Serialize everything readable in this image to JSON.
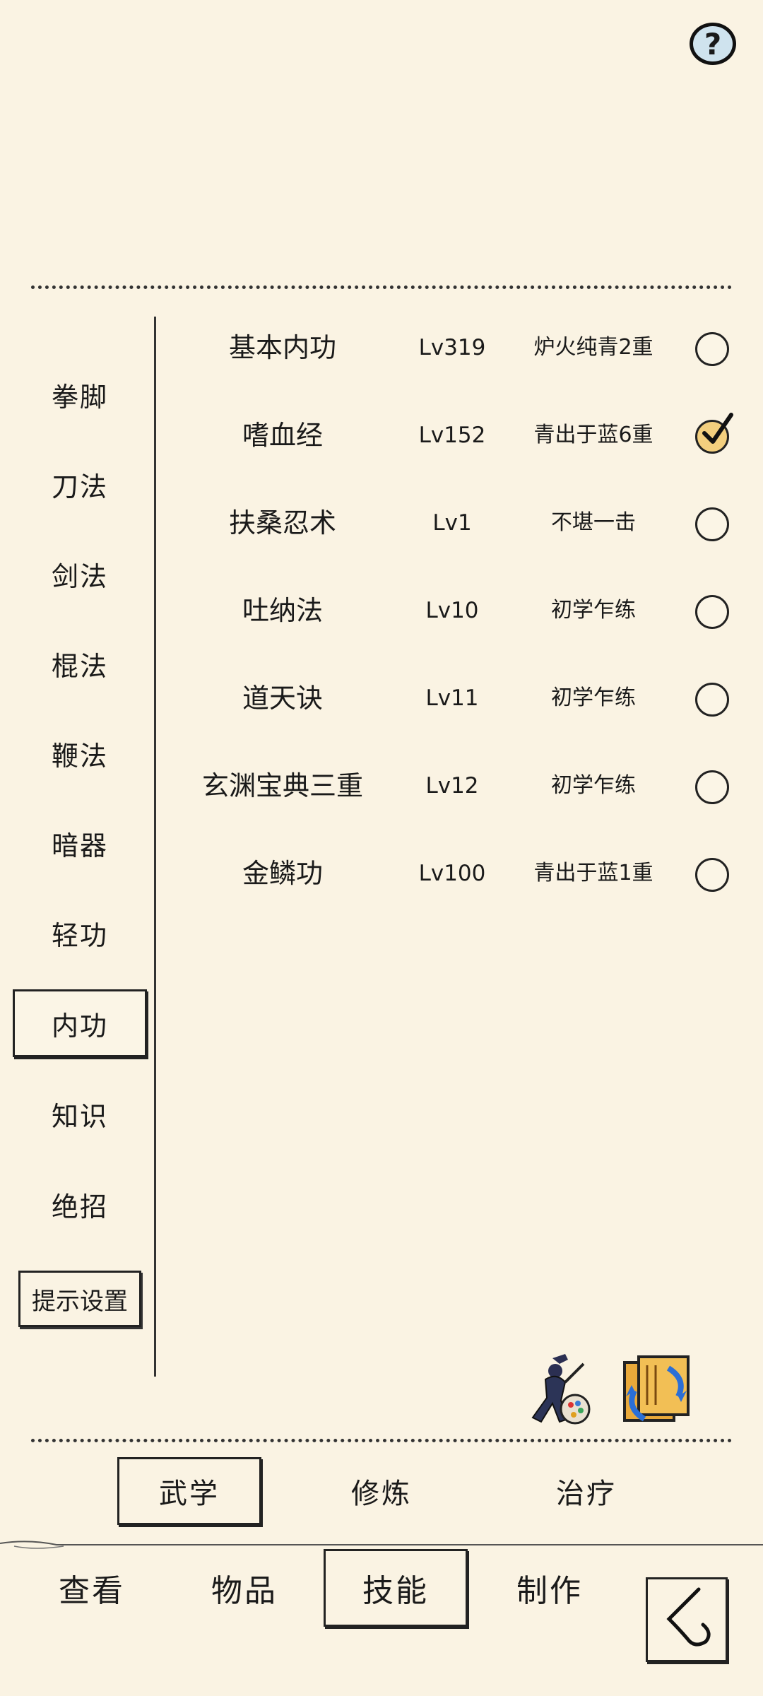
{
  "header": {
    "help_label": "?"
  },
  "categories": [
    {
      "label": "拳脚"
    },
    {
      "label": "刀法"
    },
    {
      "label": "剑法"
    },
    {
      "label": "棍法"
    },
    {
      "label": "鞭法"
    },
    {
      "label": "暗器"
    },
    {
      "label": "轻功"
    },
    {
      "label": "内功",
      "active": true
    },
    {
      "label": "知识"
    },
    {
      "label": "绝招"
    }
  ],
  "hint_settings": "提示设置",
  "skills": [
    {
      "name": "基本内功",
      "level": "Lv319",
      "rank": "炉火纯青2重",
      "checked": false
    },
    {
      "name": "嗜血经",
      "level": "Lv152",
      "rank": "青出于蓝6重",
      "checked": true
    },
    {
      "name": "扶桑忍术",
      "level": "Lv1",
      "rank": "不堪一击",
      "checked": false
    },
    {
      "name": "吐纳法",
      "level": "Lv10",
      "rank": "初学乍练",
      "checked": false
    },
    {
      "name": "道天诀",
      "level": "Lv11",
      "rank": "初学乍练",
      "checked": false
    },
    {
      "name": "玄渊宝典三重",
      "level": "Lv12",
      "rank": "初学乍练",
      "checked": false
    },
    {
      "name": "金鳞功",
      "level": "Lv100",
      "rank": "青出于蓝1重",
      "checked": false
    }
  ],
  "sub_tabs": [
    {
      "label": "武学",
      "active": true
    },
    {
      "label": "修炼"
    },
    {
      "label": "治疗"
    }
  ],
  "nav_tabs": [
    {
      "label": "查看"
    },
    {
      "label": "物品"
    },
    {
      "label": "技能",
      "active": true
    },
    {
      "label": "制作"
    }
  ],
  "colors": {
    "background": "#faf3e3",
    "check_on": "#f3cf7e",
    "help_bg": "#cfe3ee"
  }
}
